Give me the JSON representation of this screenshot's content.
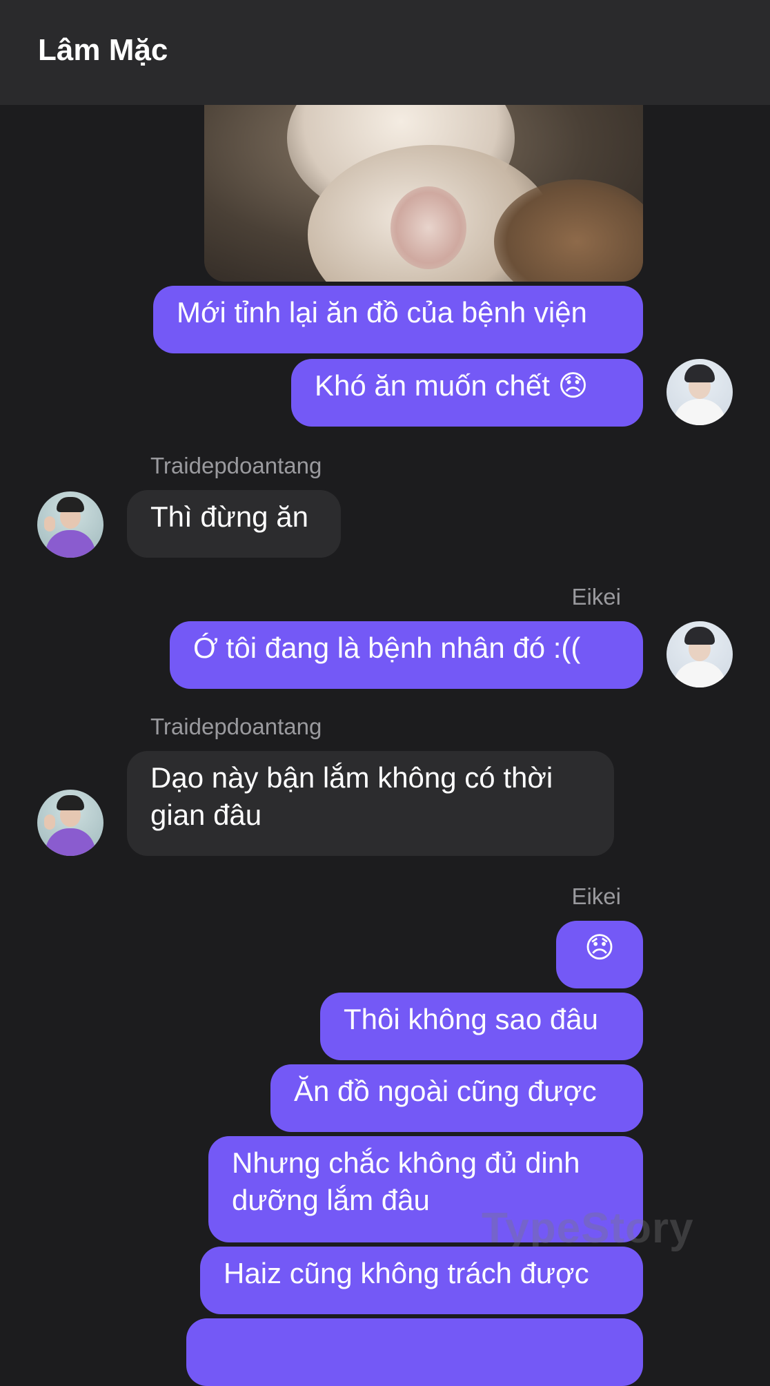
{
  "header": {
    "title": "Lâm Mặc"
  },
  "messages": {
    "m1": "Mới tỉnh lại ăn đồ của bệnh viện",
    "m2": "Khó ăn muốn chết 😞",
    "m3": "Thì đừng ăn",
    "m4": "Ớ tôi đang là bệnh nhân đó :((",
    "m5_line1": "Dạo này bận lắm không có thời",
    "m5_line2": "gian đâu",
    "m6": "😞",
    "m7": "Thôi không sao đâu",
    "m8": "Ăn đồ ngoài cũng được",
    "m9_line1": "Nhưng chắc không đủ dinh",
    "m9_line2": "dưỡng lắm đâu",
    "m10": "Haiz cũng không trách được"
  },
  "senders": {
    "s1": "Traidepdoantang",
    "s2": "Eikei",
    "s3": "Traidepdoantang",
    "s4": "Eikei"
  },
  "watermark": "TypeStory",
  "colors": {
    "background": "#1c1c1e",
    "header": "#2a2a2c",
    "outgoing_bubble": "#7459f6",
    "incoming_bubble": "#2c2c2e",
    "sender_name": "#9a9a9e"
  }
}
